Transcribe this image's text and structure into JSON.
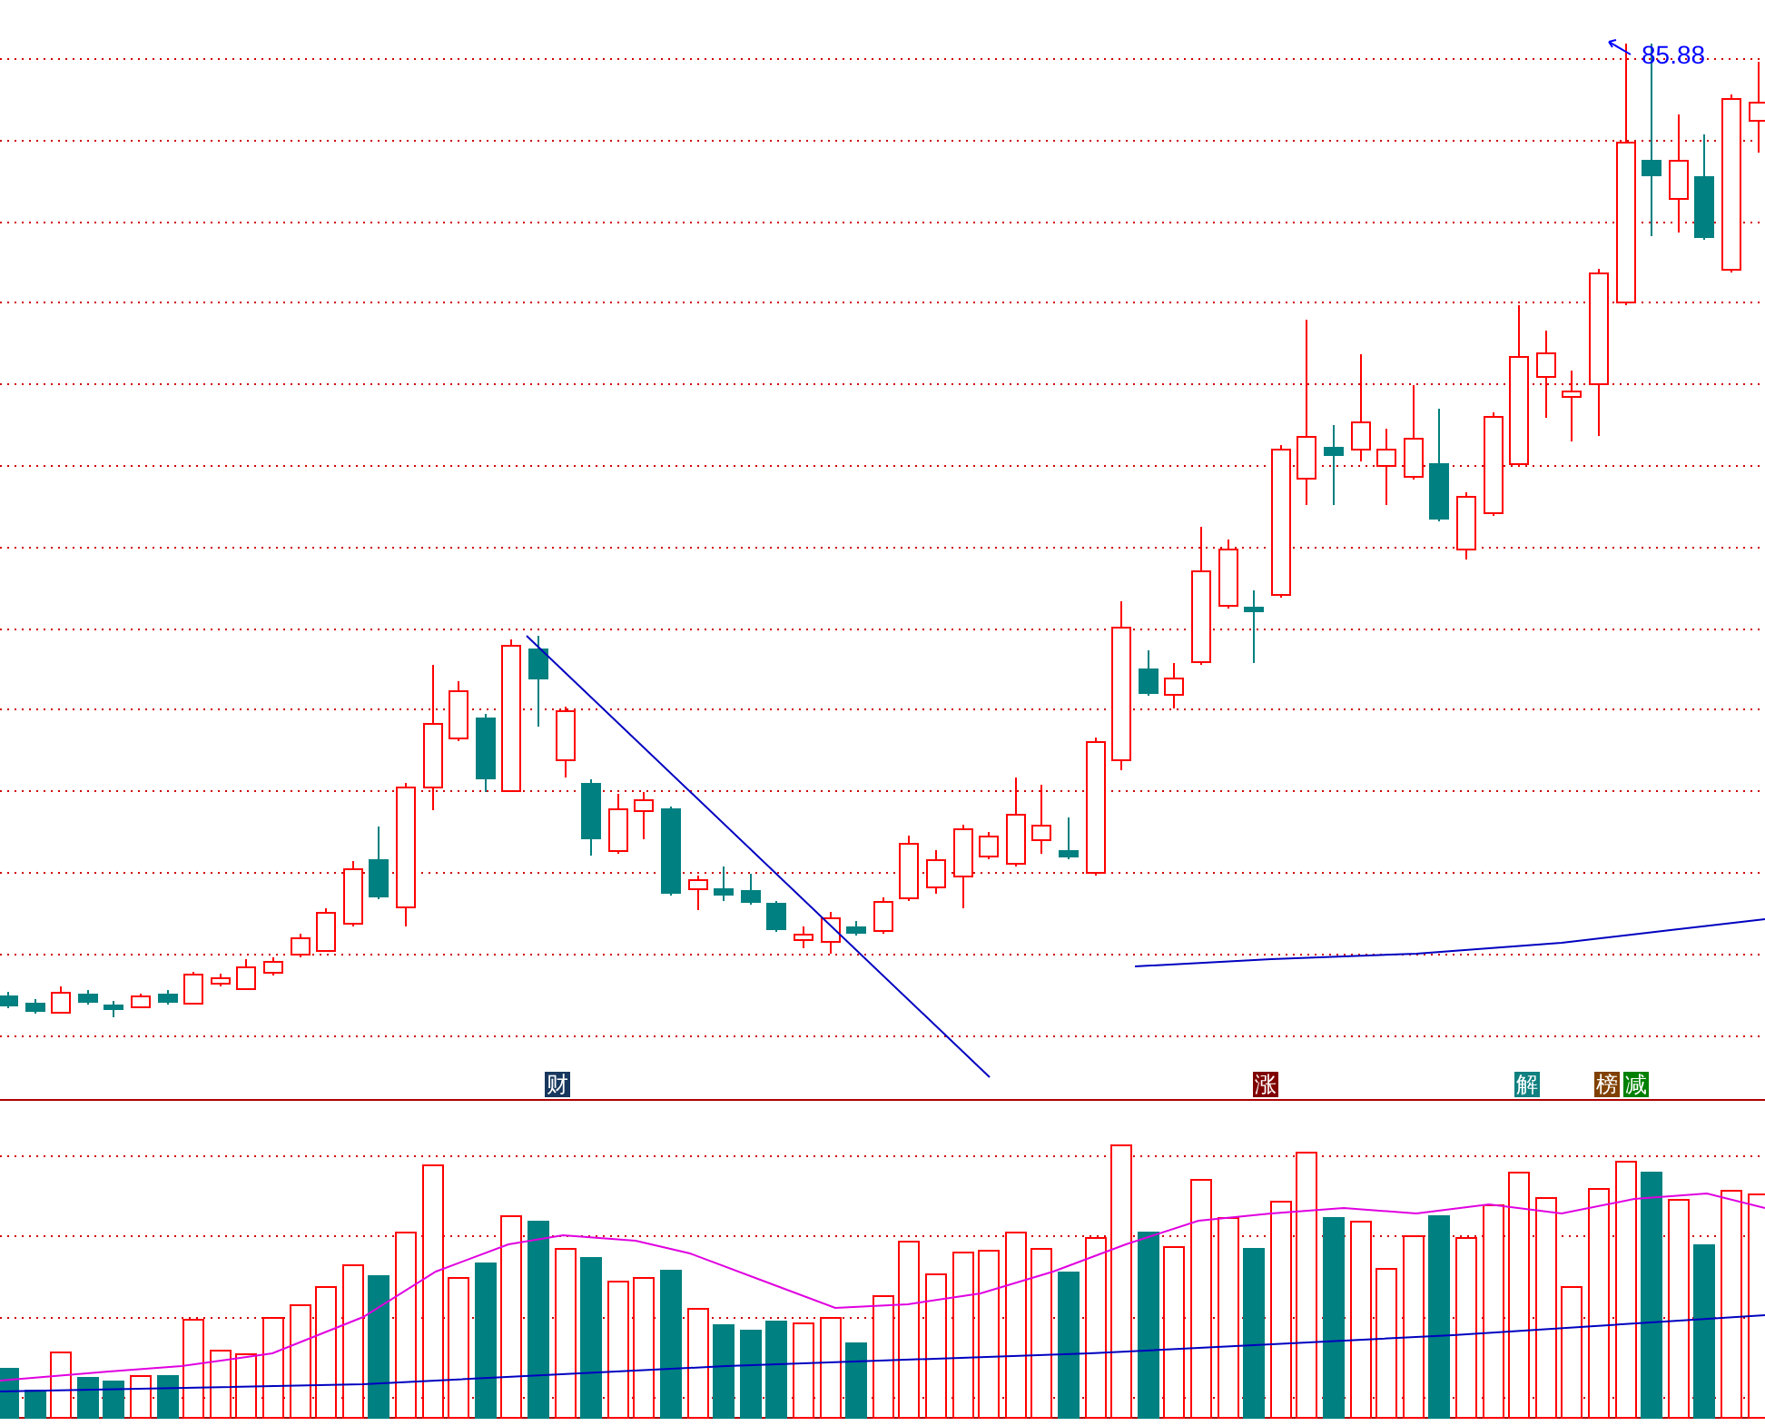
{
  "price_panel": {
    "high_label": "85.88"
  },
  "event_markers": [
    {
      "label": "财",
      "color": "#17375e"
    },
    {
      "label": "涨",
      "color": "#800000"
    },
    {
      "label": "解",
      "color": "#108080"
    },
    {
      "label": "榜",
      "color": "#804000"
    },
    {
      "label": "减",
      "color": "#008000"
    }
  ]
}
